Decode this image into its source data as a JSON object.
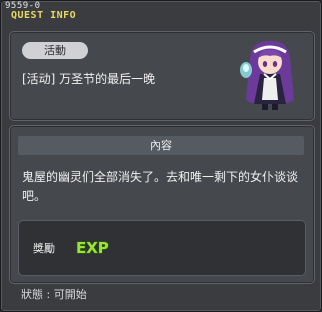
{
  "window": {
    "quest_id": "9559-0",
    "title": "QUEST INFO"
  },
  "quest": {
    "category_tag": "活動",
    "name": "[活动] 万圣节的最后一晚",
    "npc_icon": "maid-ghost-npc-icon"
  },
  "content": {
    "section_title": "內容",
    "description": "鬼屋的幽灵们全部消失了。去和唯一剩下的女仆谈谈吧。"
  },
  "reward": {
    "label": "獎勵",
    "exp_text": "EXP",
    "exp_color": "#9be33a"
  },
  "status": {
    "text": "狀態 : 可開始"
  },
  "colors": {
    "title": "#e8d860",
    "panel": "#45484d",
    "window": "#3a3c40"
  }
}
